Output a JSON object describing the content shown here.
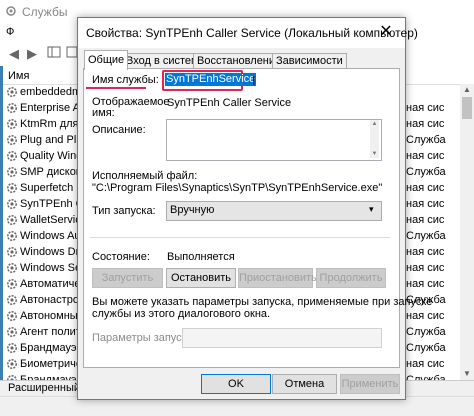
{
  "background": {
    "title": "Службы",
    "menu_file": "Ф",
    "column_name": "Имя",
    "services": [
      "embeddedm",
      "Enterprise A",
      "KtmRm для",
      "Plug and Pl",
      "Quality Wind",
      "SMP дисков",
      "Superfetch",
      "SynTPEnh Ca",
      "WalletService",
      "Windows Au",
      "Windows Dri",
      "Windows Sea",
      "Автоматиче",
      "Автонастро",
      "Автономны",
      "Агент полит",
      "Брандмауэр",
      "Биометриче",
      "Брандмауэр"
    ],
    "descriptions": [
      "",
      "ная сис",
      "ная сис",
      "Служба",
      "ная сис",
      "Служба",
      "ная сис",
      "ная сис",
      "ная сис",
      "Служба",
      "ная сис",
      "ная сис",
      "ная сис",
      "Служба",
      "ная сис",
      "Служба",
      "Служба",
      "ная сис",
      "Служба"
    ],
    "tab_extended": "Расширенный"
  },
  "dialog": {
    "title": "Свойства: SynTPEnh Caller Service (Локальный компьютер)",
    "tabs": [
      "Общие",
      "Вход в систему",
      "Восстановление",
      "Зависимости"
    ],
    "service_name_label": "Имя службы:",
    "service_name_value": "SynTPEnhService",
    "display_name_label_1": "Отображаемое",
    "display_name_label_2": "имя:",
    "display_name_value": "SynTPEnh Caller Service",
    "description_label": "Описание:",
    "exe_label": "Исполняемый файл:",
    "exe_value": "\"C:\\Program Files\\Synaptics\\SynTP\\SynTPEnhService.exe\"",
    "startup_label": "Тип запуска:",
    "startup_value": "Вручную",
    "status_label": "Состояние:",
    "status_value": "Выполняется",
    "btn_start": "Запустить",
    "btn_stop": "Остановить",
    "btn_pause": "Приостановить",
    "btn_resume": "Продолжить",
    "hint_line1": "Вы можете указать параметры запуска, применяемые при запуске",
    "hint_line2": "службы из этого диалогового окна.",
    "params_label": "Параметры запуска:",
    "btn_ok": "OK",
    "btn_cancel": "Отмена",
    "btn_apply": "Применить",
    "close_glyph": "✕"
  },
  "colors": {
    "highlight": "#e0245e",
    "selection": "#0078d7"
  }
}
